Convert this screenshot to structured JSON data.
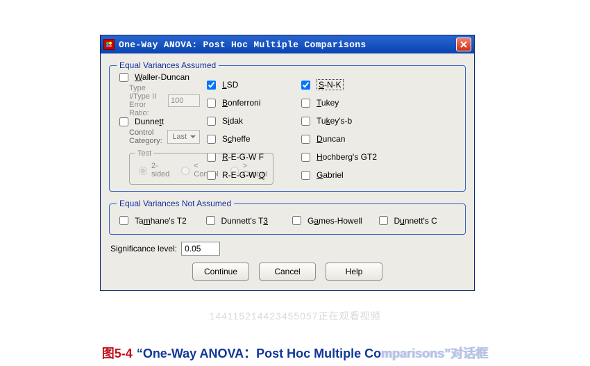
{
  "titlebar": {
    "title": "One-Way ANOVA: Post Hoc Multiple Comparisons",
    "close_icon": "close-icon"
  },
  "group_equal": {
    "legend": "Equal Variances Assumed",
    "col1": [
      {
        "label_pre": "",
        "ul": "L",
        "label_post": "SD",
        "checked": true
      },
      {
        "label_pre": "",
        "ul": "B",
        "label_post": "onferroni",
        "checked": false
      },
      {
        "label_pre": "S",
        "ul": "i",
        "label_post": "dak",
        "checked": false
      },
      {
        "label_pre": "S",
        "ul": "c",
        "label_post": "heffe",
        "checked": false
      },
      {
        "label_pre": "",
        "ul": "R",
        "label_post": "-E-G-W F",
        "checked": false
      },
      {
        "label_pre": "R-E-G-W ",
        "ul": "Q",
        "label_post": "",
        "checked": false
      }
    ],
    "col2": [
      {
        "label_pre": "",
        "ul": "S",
        "label_post": "-N-K",
        "checked": true,
        "boxed": true
      },
      {
        "label_pre": "",
        "ul": "T",
        "label_post": "ukey",
        "checked": false
      },
      {
        "label_pre": "Tu",
        "ul": "k",
        "label_post": "ey's-b",
        "checked": false
      },
      {
        "label_pre": "",
        "ul": "D",
        "label_post": "uncan",
        "checked": false
      },
      {
        "label_pre": "",
        "ul": "H",
        "label_post": "ochberg's GT2",
        "checked": false
      },
      {
        "label_pre": "",
        "ul": "G",
        "label_post": "abriel",
        "checked": false
      }
    ],
    "waller": {
      "label_pre": "",
      "ul": "W",
      "label_post": "aller-Duncan",
      "checked": false
    },
    "err_ratio_label": "Type I/Type II Error Ratio:",
    "err_ratio_value": "100",
    "dunnett": {
      "label_pre": "Dunne",
      "ul": "t",
      "label_post": "t",
      "checked": false
    },
    "control_cat_label": "Control Category:",
    "control_cat_value": "Last",
    "test_legend": "Test",
    "radios": [
      {
        "label_pre": "",
        "ul": "2",
        "label_post": "-sided",
        "checked": true
      },
      {
        "label_pre": "< C",
        "ul": "o",
        "label_post": "ntrol",
        "checked": false
      },
      {
        "label_pre": "> Co",
        "ul": "n",
        "label_post": "trol",
        "checked": false
      }
    ]
  },
  "group_unequal": {
    "legend": "Equal Variances Not Assumed",
    "items": [
      {
        "label_pre": "Ta",
        "ul": "m",
        "label_post": "hane's T2",
        "checked": false
      },
      {
        "label_pre": "Dunnett's T",
        "ul": "3",
        "label_post": "",
        "checked": false
      },
      {
        "label_pre": "G",
        "ul": "a",
        "label_post": "mes-Howell",
        "checked": false
      },
      {
        "label_pre": "D",
        "ul": "u",
        "label_post": "nnett's C",
        "checked": false
      }
    ]
  },
  "sig": {
    "label_pre": "Signi",
    "ul": "f",
    "label_post": "icance level:",
    "value": "0.05"
  },
  "buttons": {
    "continue": "Continue",
    "cancel": "Cancel",
    "help": "Help"
  },
  "watermark": "144115214423455057正在观看视频",
  "caption": {
    "fignum": "图5-4",
    "quote_open": "“",
    "main": "One-Way ANOVA：Post Hoc Multiple Co",
    "faded": "mparisons”对话框"
  }
}
